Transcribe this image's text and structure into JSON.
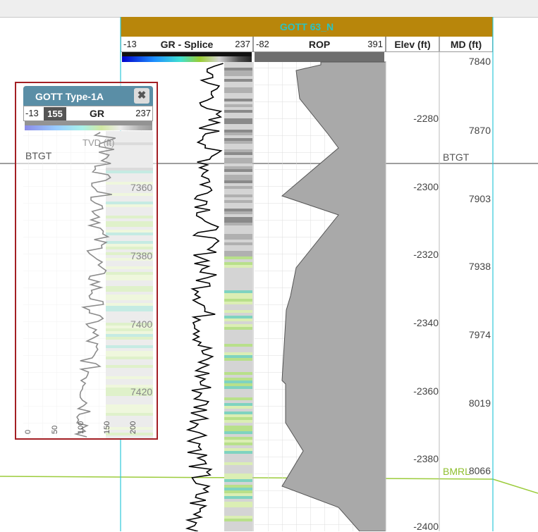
{
  "well": {
    "name": "GOTT 63_N",
    "tracks": {
      "gr": {
        "name": "GR - Splice",
        "min": "-13",
        "max": "237"
      },
      "rop": {
        "name": "ROP",
        "min": "-82",
        "max": "391"
      },
      "elev": {
        "name": "Elev (ft)"
      },
      "md": {
        "name": "MD (ft)"
      }
    },
    "elev_labels": [
      "-2280",
      "-2300",
      "-2320",
      "-2340",
      "-2360",
      "-2380",
      "-2400"
    ],
    "md_labels": [
      "7840",
      "7870",
      "7903",
      "7938",
      "7974",
      "8019",
      "8066"
    ],
    "markers": {
      "top": "BTGT",
      "bottom": "BMRL"
    }
  },
  "type_panel": {
    "title": "GOTT Type-1A",
    "curve": {
      "name": "GR",
      "min": "-13",
      "cursor_value": "155",
      "max": "237"
    },
    "depth_axis_label": "TVD (ft)",
    "depth_labels": [
      "7360",
      "7380",
      "7400",
      "7420"
    ],
    "marker": "BTGT",
    "bottom_ticks": [
      "0",
      "50",
      "100",
      "150",
      "200"
    ]
  },
  "colors": {
    "well_header": "#b8860b",
    "well_title_text": "#2bc3c3",
    "panel_border": "#a31f24",
    "panel_header": "#5a8ea6",
    "marker_bmrl": "#9ccc3c",
    "marker_btgt": "#7f7f7f",
    "rop_fill": "#a9a9a9"
  },
  "icons": {
    "close": "close-icon"
  }
}
